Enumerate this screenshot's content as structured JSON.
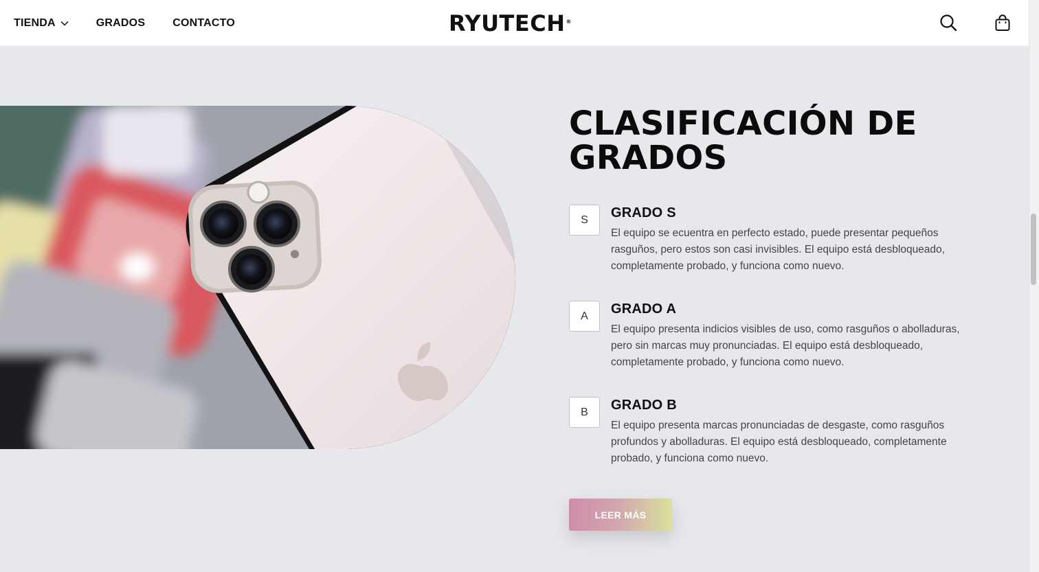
{
  "header": {
    "nav": [
      {
        "label": "TIENDA",
        "has_dropdown": true
      },
      {
        "label": "GRADOS"
      },
      {
        "label": "CONTACTO"
      }
    ],
    "logo": "RYUTECH",
    "logo_mark": "®",
    "icons": [
      "search-icon",
      "shopping-bag-icon"
    ]
  },
  "section": {
    "title_line1": "CLASIFICACIÓN DE",
    "title_line2": "GRADOS",
    "grades": [
      {
        "badge": "S",
        "title": "GRADO S",
        "description": "El equipo se ecuentra en perfecto estado, puede presentar pequeños rasguños, pero estos son casi invisibles. El equipo está desbloqueado, completamente probado, y funciona como nuevo."
      },
      {
        "badge": "A",
        "title": "GRADO A",
        "description": "El equipo presenta indicios visibles de uso, como rasguños o abolladuras, pero sin marcas muy pronunciadas. El equipo está desbloqueado, completamente probado, y funciona como nuevo."
      },
      {
        "badge": "B",
        "title": "GRADO B",
        "description": "El equipo presenta marcas pronunciadas de desgaste, como rasguños profundos y abolladuras. El equipo está desbloqueado, completamente probado, y funciona como nuevo."
      }
    ],
    "cta_label": "LEER MÁS"
  },
  "colors": {
    "background": "#e6e8ec",
    "header_bg": "#ffffff",
    "cta_gradient_start": "#cf8cab",
    "cta_gradient_end": "#d8e29c",
    "phone_body": "#efe6e6"
  }
}
